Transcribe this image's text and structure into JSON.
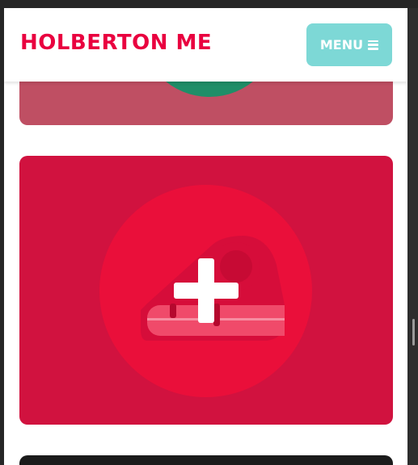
{
  "header": {
    "brand_text": "HOLBERTON ME",
    "menu_label": "MENU"
  },
  "icons": {
    "menu": "hamburger-icon",
    "card2": "cake-slice-add-icon"
  },
  "colors": {
    "brand_text": "#e9003f",
    "menu_button": "#7dd8d6",
    "card1_bg": "#bf4f63",
    "card1_shape": "#1f8e68",
    "card2_bg": "#d1123f",
    "card2_circle": "#ea0f3a",
    "card3_bg": "#1b1b1b"
  }
}
